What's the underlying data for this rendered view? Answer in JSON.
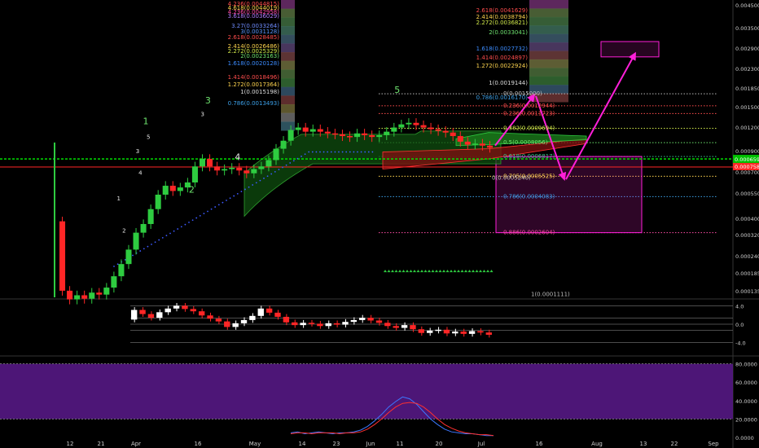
{
  "chart_data": [
    {
      "type": "candlestick",
      "panel": "price",
      "scale": "log",
      "ylim": [
        0.000115,
        0.0048
      ],
      "y_ticks": [
        "0.0045000",
        "0.0035000",
        "0.0029000",
        "0.0023000",
        "0.0018500",
        "0.0015000",
        "0.0012000",
        "0.0009000",
        "0.0007000",
        "0.0005500",
        "0.0004000",
        "0.0003200",
        "0.0002400",
        "0.0001850",
        "0.0001350"
      ],
      "last_price": "0.0007586",
      "line_price": "0.0006597",
      "price_line_value": 0.0006597,
      "candles_close": [
        0.000125,
        0.000112,
        0.000118,
        0.000113,
        0.000122,
        0.000119,
        0.00013,
        0.00015,
        0.000175,
        0.00021,
        0.00026,
        0.00029,
        0.00035,
        0.00042,
        0.00047,
        0.00044,
        0.00046,
        0.00049,
        0.0006,
        0.00066,
        0.0006,
        0.00057,
        0.00058,
        0.00059,
        0.00057,
        0.00055,
        0.00058,
        0.0006,
        0.00065,
        0.00075,
        0.00083,
        0.00095,
        0.00098,
        0.00093,
        0.00096,
        0.00093,
        0.00091,
        0.0009,
        0.00088,
        0.00087,
        0.00091,
        0.00089,
        0.00087,
        0.00089,
        0.00093,
        0.00098,
        0.00102,
        0.00104,
        0.00101,
        0.00098,
        0.00096,
        0.00094,
        0.00092,
        0.00088,
        0.00082,
        0.00079,
        0.0008,
        0.00078,
        0.00076
      ],
      "wave_labels_green": [
        {
          "text": "1",
          "date": "2018-04-09",
          "value": 0.00102
        },
        {
          "text": "2",
          "date": "2018-04-26",
          "value": 0.00043
        },
        {
          "text": "3",
          "date": "2018-05-02",
          "value": 0.00133
        },
        {
          "text": "4",
          "date": "2018-05-13",
          "value": 0.00065
        },
        {
          "text": "5",
          "date": "2018-07-11",
          "value": 0.00152
        }
      ],
      "wave_labels_small": [
        {
          "text": "1",
          "date": "2018-03-30",
          "value": 0.00039
        },
        {
          "text": "2",
          "date": "2018-04-01",
          "value": 0.00026
        },
        {
          "text": "3",
          "date": "2018-04-06",
          "value": 0.00071
        },
        {
          "text": "4",
          "date": "2018-04-07",
          "value": 0.00054
        },
        {
          "text": "5",
          "date": "2018-04-10",
          "value": 0.00085
        },
        {
          "text": "3",
          "date": "2018-04-30",
          "value": 0.00113
        }
      ],
      "fib_left": [
        {
          "text": "4.236(0.0044815)",
          "color": "#ff4d4d"
        },
        {
          "text": "4.618(0.0044019)",
          "color": "#ffd54f"
        },
        {
          "text": "4.236(0.0042958)",
          "color": "#ff4da6"
        },
        {
          "text": "3.618(0.0036029)",
          "color": "#b07cff"
        },
        {
          "text": "3.27(0.0033264)",
          "color": "#6f8cff"
        },
        {
          "text": "3(0.0031128)",
          "color": "#5a96ff"
        },
        {
          "text": "2.618(0.0028485)",
          "color": "#ff4d4d"
        },
        {
          "text": "2.414(0.0026486)",
          "color": "#ffd54f"
        },
        {
          "text": "2.272(0.0025329)",
          "color": "#d0e84a"
        },
        {
          "text": "2(0.0023163)",
          "color": "#6ee36e"
        },
        {
          "text": "1.618(0.0020128)",
          "color": "#3c8cff"
        },
        {
          "text": "1.414(0.0018496)",
          "color": "#ff4d4d"
        },
        {
          "text": "1.272(0.0017364)",
          "color": "#ffd54f"
        },
        {
          "text": "1(0.0015198)",
          "color": "#dddddd"
        },
        {
          "text": "0.786(0.0013493)",
          "color": "#3ca0e8"
        }
      ],
      "fib_right": [
        {
          "text": "2.618(0.0041629)",
          "color": "#ff4d4d"
        },
        {
          "text": "2.414(0.0038794)",
          "color": "#ffd54f"
        },
        {
          "text": "2.272(0.0036821)",
          "color": "#d0e84a"
        },
        {
          "text": "2(0.0033041)",
          "color": "#6ee36e"
        },
        {
          "text": "1.618(0.0027732)",
          "color": "#3c8cff"
        },
        {
          "text": "1.414(0.0024897)",
          "color": "#ff4d4d"
        },
        {
          "text": "1.272(0.0022924)",
          "color": "#ffd54f"
        },
        {
          "text": "1(0.0019144)",
          "color": "#dddddd"
        },
        {
          "text": "0.786(0.0016170)",
          "color": "#3ca0e8"
        }
      ],
      "retracement": [
        {
          "text": "0(0.0015000)",
          "value": 0.0015,
          "color": "#bbbbbb"
        },
        {
          "text": "0.236(0.0012944)",
          "value": 0.00129,
          "color": "#ff4d4d"
        },
        {
          "text": "0.236(0.0011723)",
          "value": 0.00117,
          "color": "#ff4d4d"
        },
        {
          "text": "0.382(0.0009694)",
          "value": 0.00097,
          "color": "#d0e84a"
        },
        {
          "text": "0.5(0.0008056)",
          "value": 0.00081,
          "color": "#6ee36e"
        },
        {
          "text": "0.618(0.0006817)",
          "value": 0.00068,
          "color": "#3cc08a"
        },
        {
          "text": "0.705(0.0005525)",
          "value": 0.00053,
          "color": "#ffd54f"
        },
        {
          "text": "0.786(0.0004083)",
          "value": 0.00041,
          "color": "#3ca0e8"
        },
        {
          "text": "0.886(0.0002604)",
          "value": 0.00026,
          "color": "#ff4da6"
        }
      ],
      "retracement_extra": [
        "0(0.0005240)",
        "1(0.0001111)"
      ],
      "x_ticks": [
        "12",
        "21",
        "Apr",
        "16",
        "May",
        "14",
        "23",
        "Jun",
        "11",
        "20",
        "Jul",
        "16",
        "Aug",
        "13",
        "22",
        "Sep"
      ],
      "colors": {
        "up": "#2ecc40",
        "down": "#ff2626",
        "projection": "#ff1fd9",
        "price_line": "#00e000",
        "target_box": "#ff1fd9",
        "ichimoku_cloud": "#1a7a1a"
      }
    },
    {
      "type": "line",
      "panel": "oscillator",
      "y_ticks": [
        "4.0",
        "0.0",
        "-4.0"
      ],
      "ylim": [
        -4.6,
        4.6
      ],
      "values": [
        3.1,
        2.2,
        1.4,
        2.6,
        3.4,
        4.0,
        3.3,
        2.8,
        1.9,
        1.2,
        0.6,
        -0.6,
        0.2,
        0.9,
        1.8,
        3.4,
        2.5,
        1.6,
        0.4,
        -0.2,
        0.3,
        0.1,
        -0.4,
        0.2,
        -0.1,
        0.5,
        0.9,
        1.4,
        0.8,
        0.3,
        -0.4,
        -0.8,
        -0.2,
        -1.1,
        -1.9,
        -1.4,
        -1.2,
        -2.0,
        -1.6,
        -2.1,
        -1.5,
        -1.8,
        -2.3
      ]
    },
    {
      "type": "line",
      "panel": "stochastic",
      "y_ticks": [
        "80.0000",
        "60.0000",
        "40.0000",
        "20.0000",
        "0.0000"
      ],
      "ylim": [
        0,
        85
      ],
      "band": [
        20,
        80
      ],
      "series": [
        {
          "color": "#3c78ff",
          "values": [
            5,
            6,
            4,
            5,
            6,
            5,
            4,
            5,
            5,
            6,
            8,
            12,
            18,
            25,
            33,
            39,
            44,
            42,
            36,
            28,
            20,
            14,
            9,
            6,
            5,
            4,
            4,
            3,
            2,
            2
          ]
        },
        {
          "color": "#ff3030",
          "values": [
            4,
            5,
            5,
            4,
            5,
            5,
            5,
            4,
            5,
            5,
            6,
            9,
            14,
            20,
            27,
            33,
            37,
            38,
            37,
            33,
            27,
            20,
            14,
            10,
            7,
            5,
            4,
            3,
            3,
            2
          ]
        }
      ]
    }
  ]
}
